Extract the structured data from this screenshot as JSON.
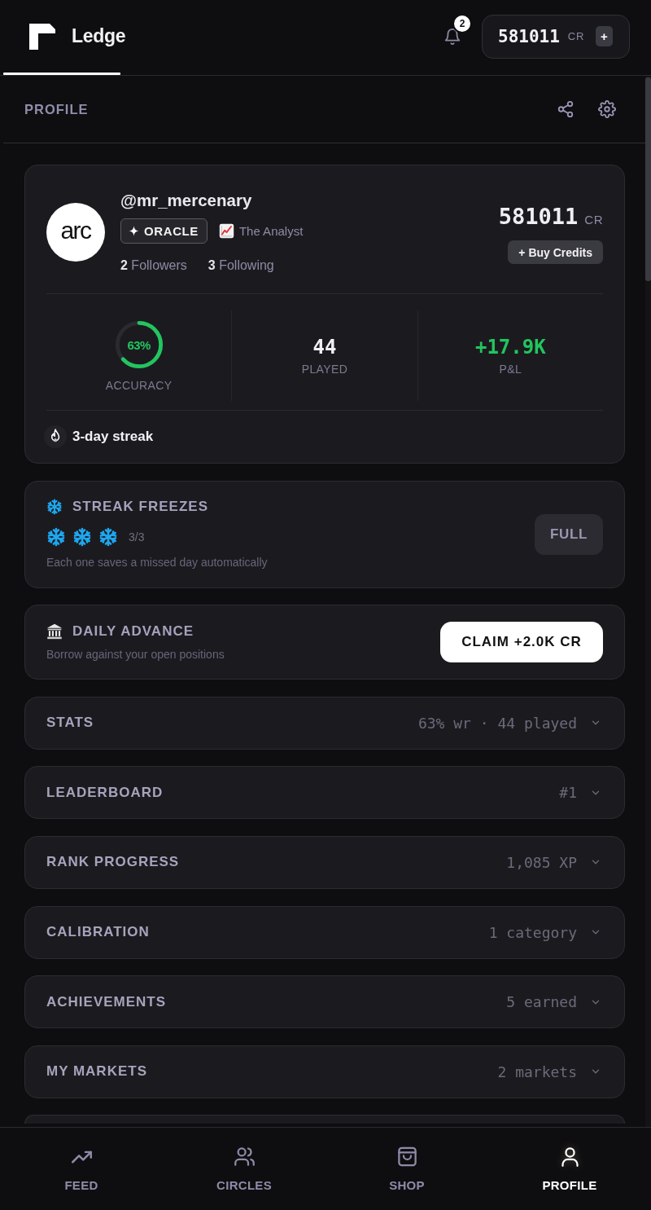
{
  "header": {
    "app_name": "Ledge",
    "notifications": {
      "count": "2"
    },
    "credits": {
      "amount": "581011",
      "unit": "CR",
      "add_label": "+"
    }
  },
  "page": {
    "title": "PROFILE"
  },
  "profile": {
    "avatar_text": "arc",
    "username": "@mr_mercenary",
    "badge": {
      "label": "ORACLE"
    },
    "title": {
      "label": "The Analyst"
    },
    "followers": {
      "count": "2",
      "label": "Followers"
    },
    "following": {
      "count": "3",
      "label": "Following"
    },
    "balance": {
      "amount": "581011",
      "unit": "CR"
    },
    "buy_button": "+ Buy Credits",
    "stats": [
      {
        "kind": "ring",
        "value": "63%",
        "label": "ACCURACY",
        "level": 0.63
      },
      {
        "kind": "number",
        "value": "44",
        "label": "PLAYED"
      },
      {
        "kind": "gain",
        "value": "+17.9K",
        "label": "P&L"
      }
    ],
    "streak": "3-day streak"
  },
  "freezes": {
    "title": "STREAK FREEZES",
    "slots": [
      {
        "filled": true
      },
      {
        "filled": true
      },
      {
        "filled": true
      }
    ],
    "count": "3/3",
    "hint": "Each one saves a missed day automatically",
    "button": "FULL"
  },
  "advance": {
    "title": "DAILY ADVANCE",
    "subtitle": "Borrow against your open positions",
    "button": "CLAIM +2.0K CR"
  },
  "sections": [
    {
      "title": "STATS",
      "summary": "63% wr · 44 played",
      "expanded": false
    },
    {
      "title": "LEADERBOARD",
      "summary": "#1",
      "expanded": false
    },
    {
      "title": "RANK PROGRESS",
      "summary": "1,085 XP",
      "expanded": false
    },
    {
      "title": "CALIBRATION",
      "summary": "1 category",
      "expanded": false
    },
    {
      "title": "ACHIEVEMENTS",
      "summary": "5 earned",
      "expanded": false
    },
    {
      "title": "MY MARKETS",
      "summary": "2 markets",
      "expanded": false
    }
  ],
  "nav": [
    {
      "label": "FEED",
      "selected": false
    },
    {
      "label": "CIRCLES",
      "selected": false
    },
    {
      "label": "SHOP",
      "selected": false
    },
    {
      "label": "PROFILE",
      "selected": true
    }
  ]
}
